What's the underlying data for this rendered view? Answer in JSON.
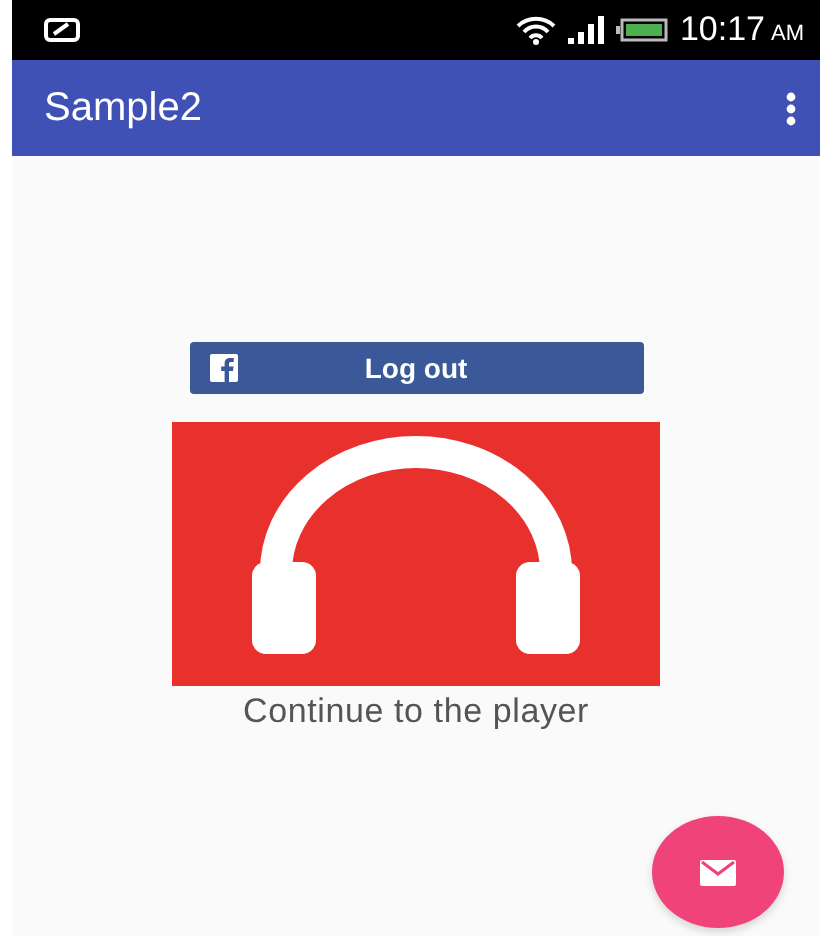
{
  "status_bar": {
    "time": "10:17",
    "meridiem": "AM"
  },
  "app_bar": {
    "title": "Sample2"
  },
  "login_button": {
    "label": "Log out"
  },
  "caption": "Continue to the player"
}
